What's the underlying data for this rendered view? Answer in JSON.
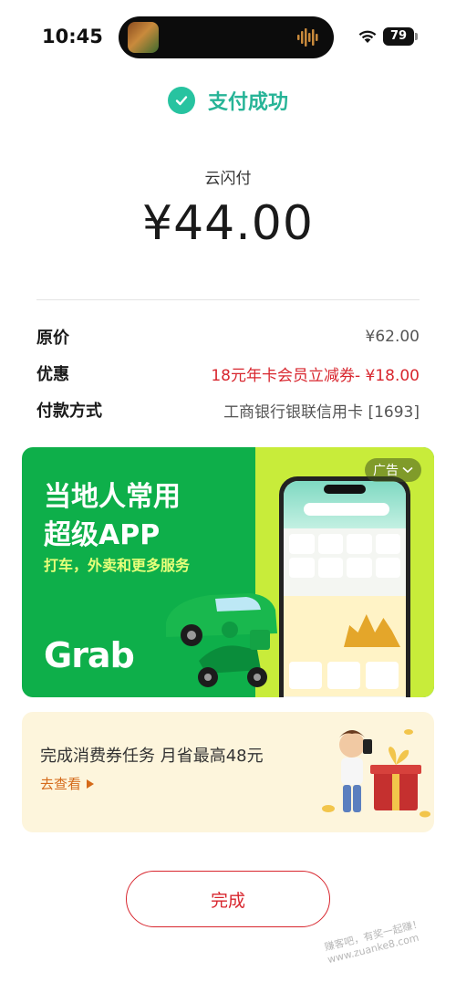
{
  "status_bar": {
    "time": "10:45",
    "battery": "79"
  },
  "header": {
    "status_text": "支付成功"
  },
  "payment": {
    "merchant": "云闪付",
    "amount": "¥44.00"
  },
  "details": {
    "original_label": "原价",
    "original_value": "¥62.00",
    "discount_label": "优惠",
    "discount_value": "18元年卡会员立减券- ¥18.00",
    "method_label": "付款方式",
    "method_value": "工商银行银联信用卡 [1693]"
  },
  "banner": {
    "title_line1": "当地人常用",
    "title_line2": "超级APP",
    "subtitle": "打车，外卖和更多服务",
    "brand": "Grab",
    "ad_tag": "广告"
  },
  "coupon": {
    "title": "完成消费券任务  月省最高48元",
    "link": "去查看"
  },
  "done_button": {
    "label": "完成"
  },
  "watermark": {
    "text": "赚客吧，有奖一起赚！www.zuanke8.com"
  },
  "colors": {
    "success": "#27c3a0",
    "accent_red": "#d8262e",
    "grab_green": "#0eaf4a",
    "lime": "#c8ec3a"
  }
}
